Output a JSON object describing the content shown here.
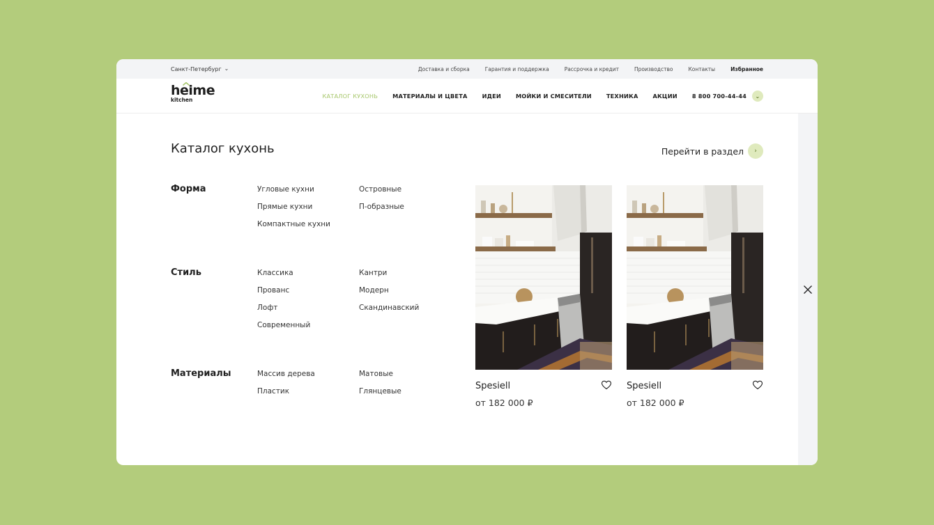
{
  "topbar": {
    "city": "Санкт-Петербург",
    "links": [
      "Доставка и сборка",
      "Гарантия и поддержка",
      "Рассрочка и кредит",
      "Производство",
      "Контакты"
    ],
    "favorites": "Избранное"
  },
  "header": {
    "logo": {
      "word": "heime",
      "sub": "kitchen"
    },
    "nav": [
      "КАТАЛОГ КУХОНЬ",
      "МАТЕРИАЛЫ И ЦВЕТА",
      "ИДЕИ",
      "МОЙКИ И СМЕСИТЕЛИ",
      "ТЕХНИКА",
      "АКЦИИ"
    ],
    "active_nav": "КАТАЛОГ КУХОНЬ",
    "phone": "8 800 700-44-44"
  },
  "catalog": {
    "title": "Каталог кухонь",
    "goto_label": "Перейти в раздел",
    "groups": [
      {
        "title": "Форма",
        "col1": [
          "Угловые кухни",
          "Прямые кухни",
          "Компактные кухни"
        ],
        "col2": [
          "Островные",
          "П-образные"
        ]
      },
      {
        "title": "Стиль",
        "col1": [
          "Классика",
          "Прованс",
          "Лофт",
          "Современный"
        ],
        "col2": [
          "Кантри",
          "Модерн",
          "Скандинавский"
        ]
      },
      {
        "title": "Материалы",
        "col1": [
          "Массив дерева",
          "Пластик"
        ],
        "col2": [
          "Матовые",
          "Глянцевые"
        ]
      }
    ]
  },
  "products": [
    {
      "name": "Spesiell",
      "price": "от 182 000 ₽"
    },
    {
      "name": "Spesiell",
      "price": "от 182 000 ₽"
    }
  ],
  "colors": {
    "background": "#b3cc7c",
    "accent": "#a6c66a",
    "accent_light": "#dfeabd",
    "topbar": "#f3f4f6"
  },
  "icons": [
    "chevron-down-icon",
    "arrow-right-icon",
    "heart-icon",
    "close-icon"
  ]
}
